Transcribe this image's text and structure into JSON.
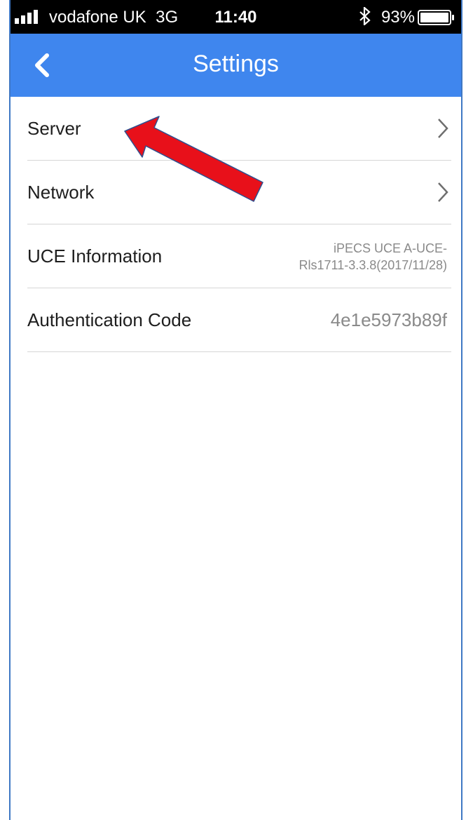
{
  "status_bar": {
    "carrier": "vodafone UK",
    "network": "3G",
    "time": "11:40",
    "battery_percent": "93%"
  },
  "nav": {
    "title": "Settings"
  },
  "settings": {
    "items": [
      {
        "label": "Server"
      },
      {
        "label": "Network"
      },
      {
        "label": "UCE Information",
        "value_line1": "iPECS UCE A-UCE-",
        "value_line2": "Rls1711-3.3.8(2017/11/28)"
      },
      {
        "label": "Authentication Code",
        "value": "4e1e5973b89f"
      }
    ]
  },
  "colors": {
    "nav_bg": "#3f86ee",
    "annotation_arrow": "#e8101a"
  },
  "icons": {
    "back": "chevron-left-icon",
    "row_chevron": "chevron-right-icon",
    "annotation": "red-arrow-annotation"
  }
}
